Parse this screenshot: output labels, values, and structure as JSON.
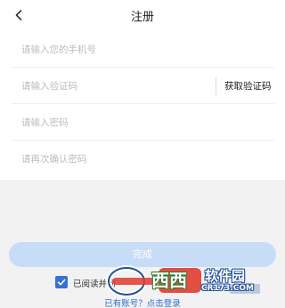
{
  "header": {
    "title": "注册"
  },
  "form": {
    "phone_placeholder": "请输入您的手机号",
    "code_placeholder": "请输入验证码",
    "get_code_label": "获取验证码",
    "password_placeholder": "请输入密码",
    "confirm_password_placeholder": "请再次确认密码"
  },
  "actions": {
    "submit_label": "完成",
    "submit_color": "#c7dcf6"
  },
  "agreement": {
    "text": "已阅读并同",
    "checked": true,
    "checkbox_color": "#3a6fd8"
  },
  "footer": {
    "login_link": "已有账号？点击登录",
    "link_color": "#2b6fd4"
  },
  "watermark": {
    "main": "西西",
    "brand": "软件园",
    "site": "CR173.COM"
  }
}
